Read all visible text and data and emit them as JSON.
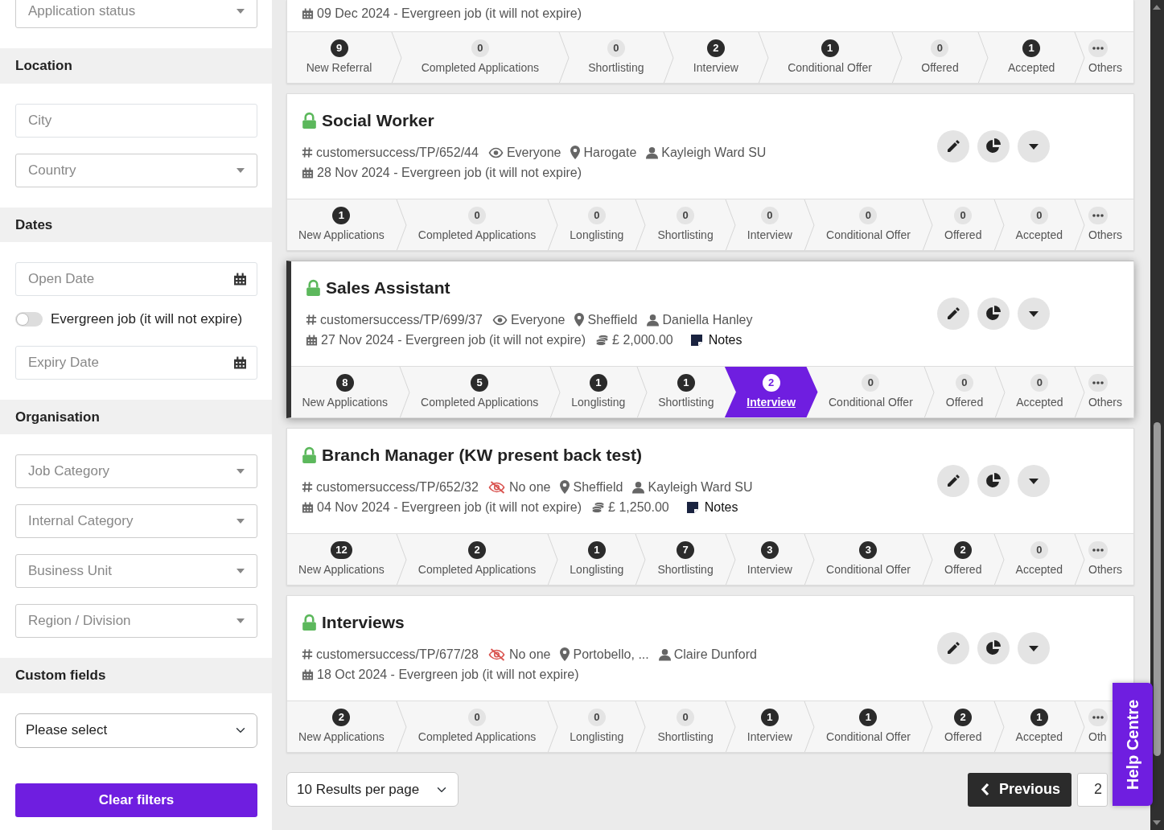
{
  "sidebar": {
    "items": [
      {
        "kind": "select",
        "placeholder": "Application status"
      },
      {
        "kind": "heading",
        "label": "Location"
      },
      {
        "kind": "input",
        "placeholder": "City"
      },
      {
        "kind": "select",
        "placeholder": "Country"
      },
      {
        "kind": "heading",
        "label": "Dates"
      },
      {
        "kind": "date",
        "placeholder": "Open Date"
      },
      {
        "kind": "toggle",
        "label": "Evergreen job (it will not expire)",
        "on": false
      },
      {
        "kind": "date",
        "placeholder": "Expiry Date"
      },
      {
        "kind": "heading",
        "label": "Organisation"
      },
      {
        "kind": "select",
        "placeholder": "Job Category"
      },
      {
        "kind": "select",
        "placeholder": "Internal Category"
      },
      {
        "kind": "select",
        "placeholder": "Business Unit"
      },
      {
        "kind": "select",
        "placeholder": "Region / Division"
      },
      {
        "kind": "heading",
        "label": "Custom fields"
      },
      {
        "kind": "native_select",
        "value": "Please select"
      },
      {
        "kind": "button",
        "label": "Clear filters"
      }
    ]
  },
  "jobs": [
    {
      "selected": false,
      "date": "09 Dec 2024 - Evergreen job (it will not expire)",
      "stages": [
        {
          "label": "New Referral",
          "count": "9",
          "kind": "stage",
          "selected": false
        },
        {
          "label": "Completed Applications",
          "count": "0",
          "kind": "stage",
          "selected": false
        },
        {
          "label": "Shortlisting",
          "count": "0",
          "kind": "stage",
          "selected": false
        },
        {
          "label": "Interview",
          "count": "2",
          "kind": "stage",
          "selected": false
        },
        {
          "label": "Conditional Offer",
          "count": "1",
          "kind": "stage",
          "selected": false
        },
        {
          "label": "Offered",
          "count": "0",
          "kind": "stage",
          "selected": false
        },
        {
          "label": "Accepted",
          "count": "1",
          "kind": "stage",
          "selected": false
        },
        {
          "label": "Others",
          "kind": "others",
          "selected": false
        }
      ]
    },
    {
      "title": "Social Worker",
      "selected": false,
      "reference": "customersuccess/TP/652/44",
      "visibility": {
        "label": "Everyone",
        "kind": "public"
      },
      "location": "Harogate",
      "owner": "Kayleigh Ward SU",
      "date": "28 Nov 2024 - Evergreen job (it will not expire)",
      "stages": [
        {
          "label": "New Applications",
          "count": "1",
          "kind": "stage",
          "selected": false
        },
        {
          "label": "Completed Applications",
          "count": "0",
          "kind": "stage",
          "selected": false
        },
        {
          "label": "Longlisting",
          "count": "0",
          "kind": "stage",
          "selected": false
        },
        {
          "label": "Shortlisting",
          "count": "0",
          "kind": "stage",
          "selected": false
        },
        {
          "label": "Interview",
          "count": "0",
          "kind": "stage",
          "selected": false
        },
        {
          "label": "Conditional Offer",
          "count": "0",
          "kind": "stage",
          "selected": false
        },
        {
          "label": "Offered",
          "count": "0",
          "kind": "stage",
          "selected": false
        },
        {
          "label": "Accepted",
          "count": "0",
          "kind": "stage",
          "selected": false
        },
        {
          "label": "Others",
          "kind": "others",
          "selected": false
        }
      ]
    },
    {
      "title": "Sales Assistant",
      "selected": true,
      "reference": "customersuccess/TP/699/37",
      "visibility": {
        "label": "Everyone",
        "kind": "public"
      },
      "location": "Sheffield",
      "owner": "Daniella Hanley",
      "date": "27 Nov 2024 - Evergreen job (it will not expire)",
      "salary": "£ 2,000.00",
      "notes": "Notes",
      "stages": [
        {
          "label": "New Applications",
          "count": "8",
          "kind": "stage",
          "selected": false
        },
        {
          "label": "Completed Applications",
          "count": "5",
          "kind": "stage",
          "selected": false
        },
        {
          "label": "Longlisting",
          "count": "1",
          "kind": "stage",
          "selected": false
        },
        {
          "label": "Shortlisting",
          "count": "1",
          "kind": "stage",
          "selected": false
        },
        {
          "label": "Interview",
          "count": "2",
          "kind": "stage",
          "selected": true
        },
        {
          "label": "Conditional Offer",
          "count": "0",
          "kind": "stage",
          "selected": false
        },
        {
          "label": "Offered",
          "count": "0",
          "kind": "stage",
          "selected": false
        },
        {
          "label": "Accepted",
          "count": "0",
          "kind": "stage",
          "selected": false
        },
        {
          "label": "Others",
          "kind": "others",
          "selected": false
        }
      ]
    },
    {
      "title": "Branch Manager (KW present back test)",
      "selected": false,
      "reference": "customersuccess/TP/652/32",
      "visibility": {
        "label": "No one",
        "kind": "hidden"
      },
      "location": "Sheffield",
      "owner": "Kayleigh Ward SU",
      "date": "04 Nov 2024 - Evergreen job (it will not expire)",
      "salary": "£ 1,250.00",
      "notes": "Notes",
      "stages": [
        {
          "label": "New Applications",
          "count": "12",
          "kind": "stage",
          "selected": false
        },
        {
          "label": "Completed Applications",
          "count": "2",
          "kind": "stage",
          "selected": false
        },
        {
          "label": "Longlisting",
          "count": "1",
          "kind": "stage",
          "selected": false
        },
        {
          "label": "Shortlisting",
          "count": "7",
          "kind": "stage",
          "selected": false
        },
        {
          "label": "Interview",
          "count": "3",
          "kind": "stage",
          "selected": false
        },
        {
          "label": "Conditional Offer",
          "count": "3",
          "kind": "stage",
          "selected": false
        },
        {
          "label": "Offered",
          "count": "2",
          "kind": "stage",
          "selected": false
        },
        {
          "label": "Accepted",
          "count": "0",
          "kind": "stage",
          "selected": false
        },
        {
          "label": "Others",
          "kind": "others",
          "selected": false
        }
      ]
    },
    {
      "title": "Interviews",
      "selected": false,
      "reference": "customersuccess/TP/677/28",
      "visibility": {
        "label": "No one",
        "kind": "hidden"
      },
      "location": "Portobello, ...",
      "owner": "Claire Dunford",
      "date": "18 Oct 2024 - Evergreen job (it will not expire)",
      "stages": [
        {
          "label": "New Applications",
          "count": "2",
          "kind": "stage",
          "selected": false
        },
        {
          "label": "Completed Applications",
          "count": "0",
          "kind": "stage",
          "selected": false
        },
        {
          "label": "Longlisting",
          "count": "0",
          "kind": "stage",
          "selected": false
        },
        {
          "label": "Shortlisting",
          "count": "0",
          "kind": "stage",
          "selected": false
        },
        {
          "label": "Interview",
          "count": "1",
          "kind": "stage",
          "selected": false
        },
        {
          "label": "Conditional Offer",
          "count": "1",
          "kind": "stage",
          "selected": false
        },
        {
          "label": "Offered",
          "count": "2",
          "kind": "stage",
          "selected": false
        },
        {
          "label": "Accepted",
          "count": "1",
          "kind": "stage",
          "selected": false
        },
        {
          "label": "Oth",
          "kind": "others",
          "selected": false
        }
      ]
    }
  ],
  "pagination": {
    "per_page": "10 Results per page",
    "previous": "Previous",
    "page": "2"
  },
  "help": {
    "label": "Help Centre"
  }
}
